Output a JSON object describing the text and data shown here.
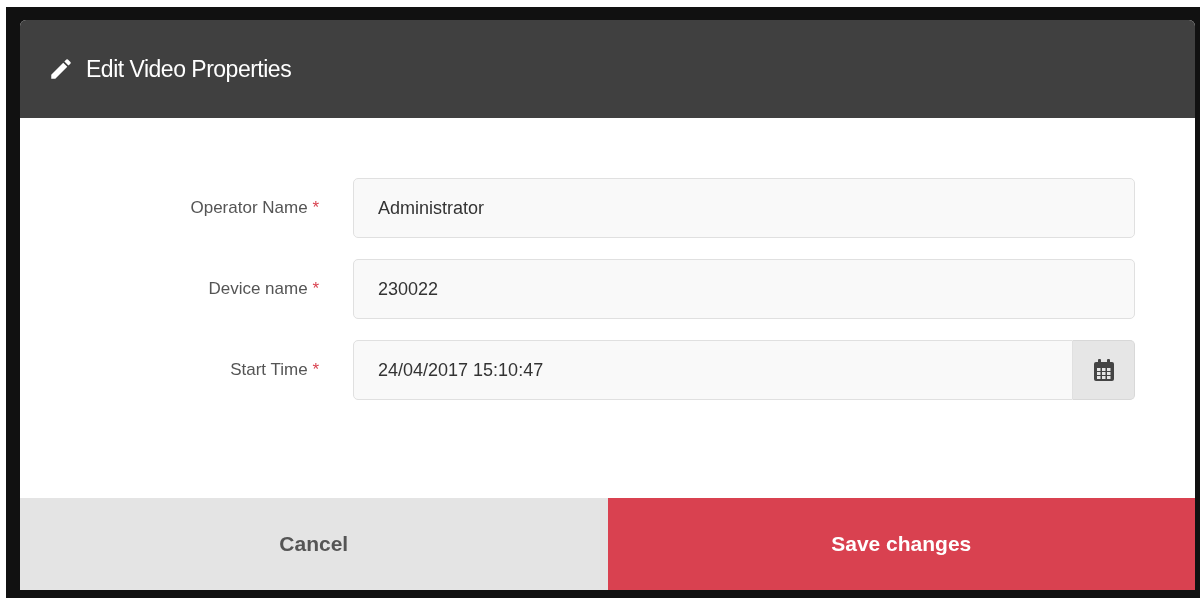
{
  "dialog": {
    "title": "Edit Video Properties"
  },
  "fields": [
    {
      "kind": "text",
      "label": "Operator Name",
      "required_mark": "*",
      "value": "Administrator"
    },
    {
      "kind": "text",
      "label": "Device name",
      "required_mark": "*",
      "value": "230022"
    },
    {
      "kind": "date",
      "label": "Start Time",
      "required_mark": "*",
      "value": "24/04/2017 15:10:47"
    }
  ],
  "buttons": [
    {
      "kind": "cancel",
      "label": "Cancel"
    },
    {
      "kind": "primary",
      "label": "Save changes"
    }
  ]
}
